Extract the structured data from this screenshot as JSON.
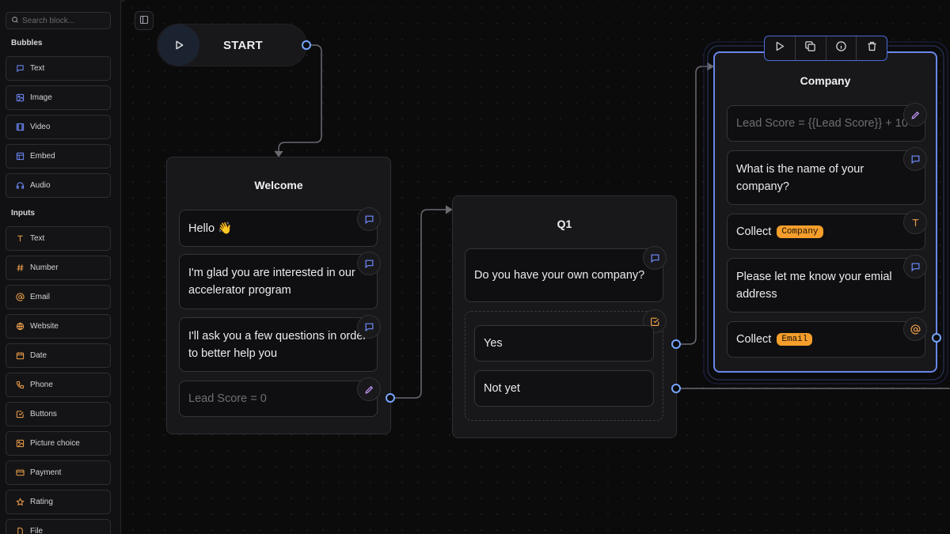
{
  "sidebar": {
    "search_placeholder": "Search block...",
    "bubbles_title": "Bubbles",
    "bubbles": [
      {
        "label": "Text",
        "icon": "message-icon"
      },
      {
        "label": "Image",
        "icon": "image-icon"
      },
      {
        "label": "Video",
        "icon": "video-icon"
      },
      {
        "label": "Embed",
        "icon": "embed-icon"
      },
      {
        "label": "Audio",
        "icon": "headphones-icon"
      }
    ],
    "inputs_title": "Inputs",
    "inputs": [
      {
        "label": "Text",
        "icon": "text-icon"
      },
      {
        "label": "Number",
        "icon": "hash-icon"
      },
      {
        "label": "Email",
        "icon": "at-icon"
      },
      {
        "label": "Website",
        "icon": "globe-icon"
      },
      {
        "label": "Date",
        "icon": "calendar-icon"
      },
      {
        "label": "Phone",
        "icon": "phone-icon"
      },
      {
        "label": "Buttons",
        "icon": "checkbox-icon"
      },
      {
        "label": "Picture choice",
        "icon": "image-icon"
      },
      {
        "label": "Payment",
        "icon": "credit-card-icon"
      },
      {
        "label": "Rating",
        "icon": "star-icon"
      },
      {
        "label": "File",
        "icon": "file-icon"
      }
    ]
  },
  "start": {
    "label": "START"
  },
  "welcome": {
    "title": "Welcome",
    "cards": [
      "Hello 👋",
      "I'm glad you are interested in our accelerator program",
      "I'll ask you a few questions in order to better help you"
    ],
    "set_variable": "Lead Score = 0"
  },
  "q1": {
    "title": "Q1",
    "question": "Do you have your own company?",
    "choices": [
      "Yes",
      "Not yet"
    ]
  },
  "company": {
    "title": "Company",
    "set_variable": "Lead Score = {{Lead Score}} + 10",
    "question1": "What is the name of your company?",
    "collect1_label": "Collect",
    "collect1_var": "Company",
    "question2": "Please let me know your emial address",
    "collect2_label": "Collect",
    "collect2_var": "Email"
  },
  "colors": {
    "accent": "#77a6ff",
    "variable_pill": "#f59e2b",
    "bubble_icon": "#6f8cff",
    "input_icon": "#f0a04b"
  }
}
